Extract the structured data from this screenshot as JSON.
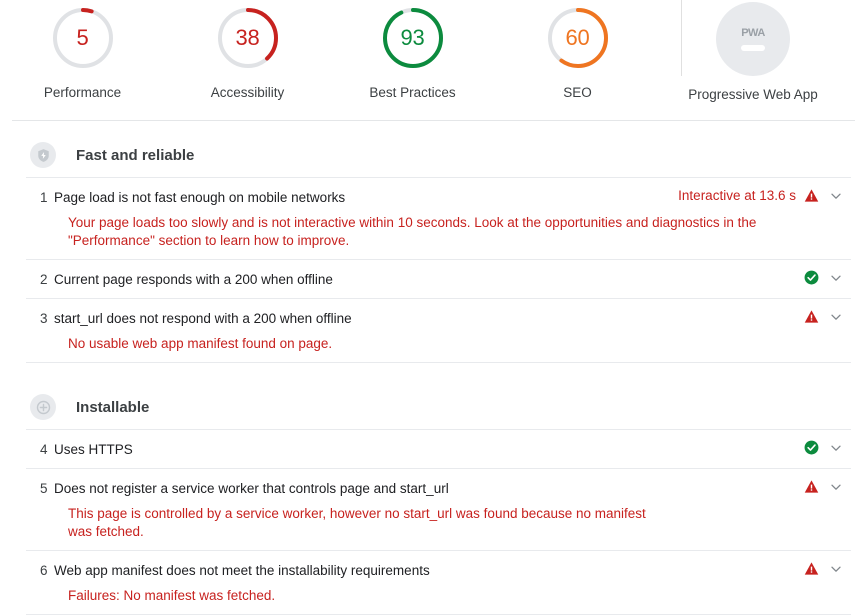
{
  "scores": {
    "items": [
      {
        "label": "Performance",
        "value": "5",
        "score": 5,
        "color": "#c7221f",
        "icon": "gauge-arc"
      },
      {
        "label": "Accessibility",
        "value": "38",
        "score": 38,
        "color": "#c7221f",
        "icon": "gauge-arc"
      },
      {
        "label": "Best Practices",
        "value": "93",
        "score": 93,
        "color": "#0c8b3e",
        "icon": "gauge-arc"
      },
      {
        "label": "SEO",
        "value": "60",
        "score": 60,
        "color": "#ef7521",
        "icon": "gauge-arc"
      }
    ],
    "pwa": {
      "label": "Progressive Web App",
      "badge_text": "PWA",
      "badge_color": "#e8eaed",
      "icon": "pwa-badge-icon"
    },
    "track_color": "#e0e2e5"
  },
  "sections": [
    {
      "title": "Fast and reliable",
      "icon": "bolt-shield-icon",
      "audits": [
        {
          "index": "1",
          "title": "Page load is not fast enough on mobile networks",
          "metric": "Interactive at 13.6 s",
          "status": "fail",
          "status_icon": "warning-triangle-icon",
          "description": "Your page loads too slowly and is not interactive within 10 seconds. Look at the opportunities and diagnostics in the \"Performance\" section to learn how to improve.",
          "chevron_icon": "chevron-down-icon"
        },
        {
          "index": "2",
          "title": "Current page responds with a 200 when offline",
          "metric": "",
          "status": "pass",
          "status_icon": "check-circle-icon",
          "description": "",
          "chevron_icon": "chevron-down-icon"
        },
        {
          "index": "3",
          "title": "start_url does not respond with a 200 when offline",
          "metric": "",
          "status": "fail",
          "status_icon": "warning-triangle-icon",
          "description": "No usable web app manifest found on page.",
          "chevron_icon": "chevron-down-icon"
        }
      ]
    },
    {
      "title": "Installable",
      "icon": "plus-circle-icon",
      "audits": [
        {
          "index": "4",
          "title": "Uses HTTPS",
          "metric": "",
          "status": "pass",
          "status_icon": "check-circle-icon",
          "description": "",
          "chevron_icon": "chevron-down-icon"
        },
        {
          "index": "5",
          "title": "Does not register a service worker that controls page and start_url",
          "metric": "",
          "status": "fail",
          "status_icon": "warning-triangle-icon",
          "description": "This page is controlled by a service worker, however no start_url was found because no manifest was fetched.",
          "chevron_icon": "chevron-down-icon"
        },
        {
          "index": "6",
          "title": "Web app manifest does not meet the installability requirements",
          "metric": "",
          "status": "fail",
          "status_icon": "warning-triangle-icon",
          "description": "Failures: No manifest was fetched.",
          "chevron_icon": "chevron-down-icon"
        }
      ]
    }
  ],
  "colors": {
    "fail": "#c7221f",
    "pass": "#0c8b3e",
    "average": "#ef7521",
    "divider": "#e8eaed"
  }
}
